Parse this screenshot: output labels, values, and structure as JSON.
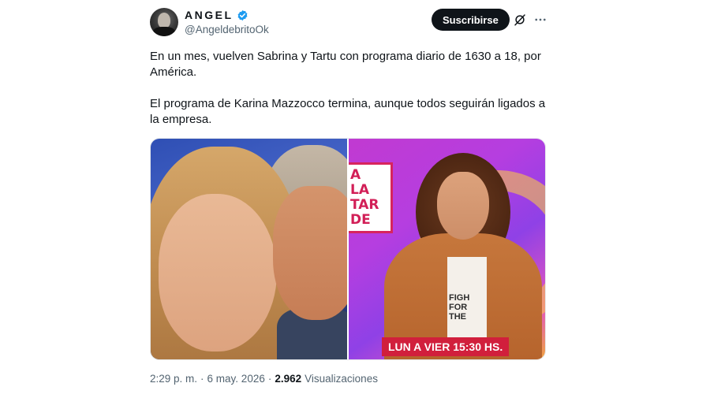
{
  "author": {
    "display_name": "ANGEL",
    "handle": "@AngeldebritoOk",
    "avatar_icon": "avatar-photo",
    "verified_icon": "verified-badge-icon",
    "verified_color": "#1d9bf0"
  },
  "actions": {
    "subscribe_label": "Suscribirse",
    "grok_icon": "slash-circle-icon",
    "more_icon": "more-dots-icon"
  },
  "post": {
    "paragraph_1": "En un mes, vuelven Sabrina y Tartu con programa diario de 1630 a 18, por América.",
    "paragraph_2": "El programa de Karina Mazzocco termina, aunque todos seguirán ligados a la empresa."
  },
  "media": {
    "right_logo_lines": [
      "A",
      "LA",
      "TAR",
      "DE"
    ],
    "shirt_print_lines": [
      "FIGH",
      "FOR",
      "THE"
    ],
    "lower_third": "LUN A VIER 15:30 HS."
  },
  "meta": {
    "time": "2:29 p. m.",
    "separator": "·",
    "date": "6 may. 2026",
    "views_count": "2.962",
    "views_label": "Visualizaciones"
  }
}
